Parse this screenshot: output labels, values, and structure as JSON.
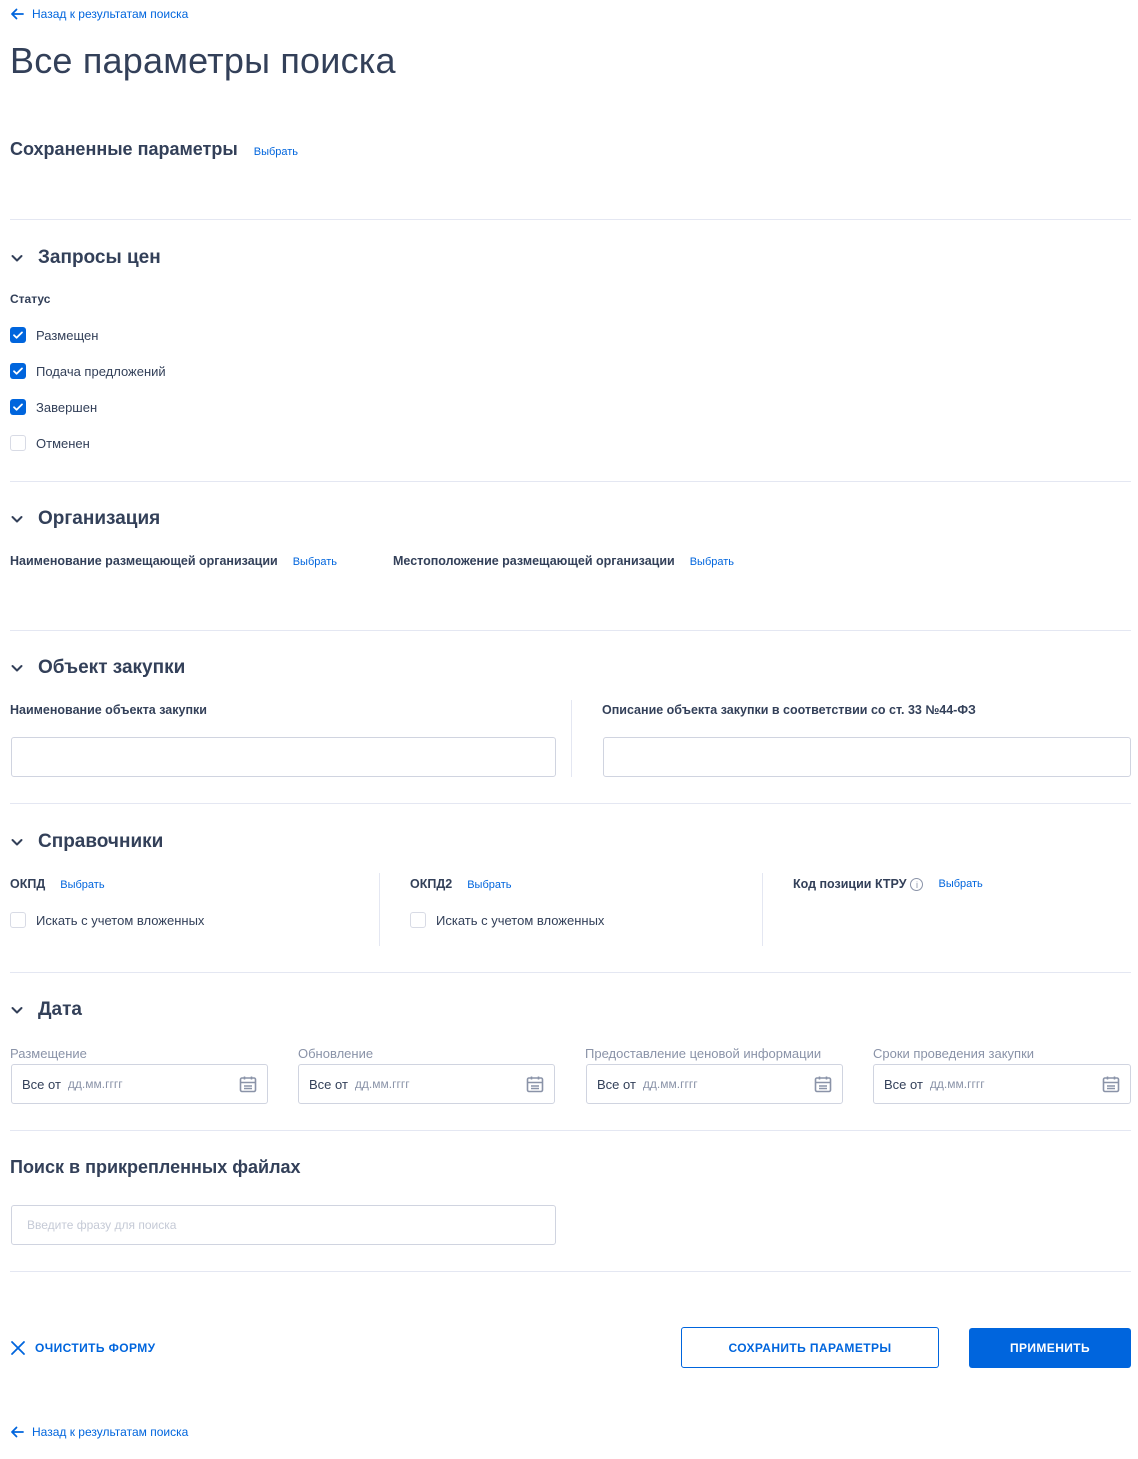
{
  "back_link": {
    "label": "Назад к результатам поиска"
  },
  "page_title": "Все параметры поиска",
  "saved_params": {
    "title": "Сохраненные параметры",
    "action": "Выбрать"
  },
  "price_requests": {
    "title": "Запросы цен",
    "status_label": "Статус",
    "statuses": [
      {
        "label": "Размещен",
        "checked": true
      },
      {
        "label": "Подача предложений",
        "checked": true
      },
      {
        "label": "Завершен",
        "checked": true
      },
      {
        "label": "Отменен",
        "checked": false
      }
    ]
  },
  "organization": {
    "title": "Организация",
    "name_label": "Наименование размещающей организации",
    "name_action": "Выбрать",
    "location_label": "Местоположение размещающей организации",
    "location_action": "Выбрать"
  },
  "purchase_object": {
    "title": "Объект закупки",
    "name_label": "Наименование объекта закупки",
    "name_value": "",
    "description_label": "Описание объекта закупки в соответствии со ст. 33 №44-ФЗ",
    "description_value": ""
  },
  "directories": {
    "title": "Справочники",
    "okpd_label": "ОКПД",
    "okpd_action": "Выбрать",
    "okpd_nested": "Искать с учетом вложенных",
    "okpd2_label": "ОКПД2",
    "okpd2_action": "Выбрать",
    "okpd2_nested": "Искать с учетом вложенных",
    "ktru_label": "Код позиции КТРУ",
    "ktru_info": "i",
    "ktru_action": "Выбрать"
  },
  "date": {
    "title": "Дата",
    "fields": [
      {
        "label": "Размещение",
        "prefix": "Все от",
        "placeholder": "дд.мм.гггг"
      },
      {
        "label": "Обновление",
        "prefix": "Все от",
        "placeholder": "дд.мм.гггг"
      },
      {
        "label": "Предоставление ценовой информации",
        "prefix": "Все от",
        "placeholder": "дд.мм.гггг"
      },
      {
        "label": "Сроки проведения закупки",
        "prefix": "Все от",
        "placeholder": "дд.мм.гггг"
      }
    ]
  },
  "file_search": {
    "title": "Поиск в прикрепленных файлах",
    "placeholder": "Введите фразу для поиска"
  },
  "actions": {
    "clear": "ОЧИСТИТЬ ФОРМУ",
    "save": "СОХРАНИТЬ ПАРАМЕТРЫ",
    "apply": "ПРИМЕНИТЬ"
  },
  "colors": {
    "accent": "#0065dd",
    "text": "#334059",
    "muted": "#8a93a8",
    "divider": "#e4e7f2"
  }
}
